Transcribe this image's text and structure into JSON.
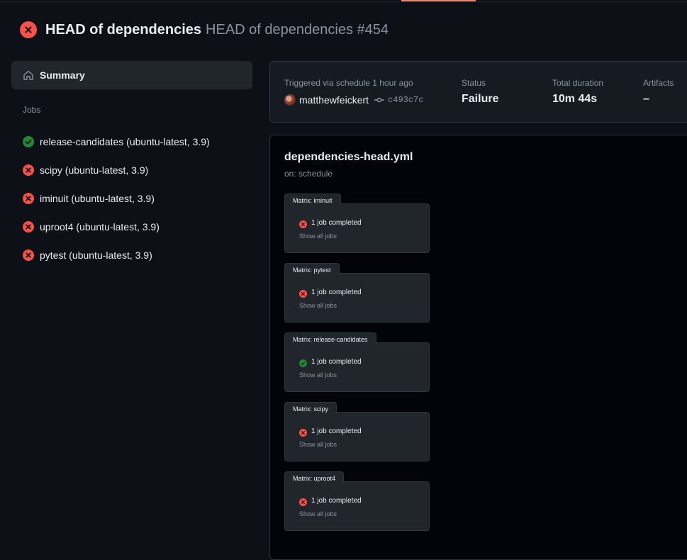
{
  "header": {
    "workflow_title": "HEAD of dependencies",
    "run_title": "HEAD of dependencies #454"
  },
  "sidebar": {
    "summary_label": "Summary",
    "jobs_heading": "Jobs",
    "jobs": [
      {
        "label": "release-candidates (ubuntu-latest, 3.9)",
        "status": "success"
      },
      {
        "label": "scipy (ubuntu-latest, 3.9)",
        "status": "failure"
      },
      {
        "label": "iminuit (ubuntu-latest, 3.9)",
        "status": "failure"
      },
      {
        "label": "uproot4 (ubuntu-latest, 3.9)",
        "status": "failure"
      },
      {
        "label": "pytest (ubuntu-latest, 3.9)",
        "status": "failure"
      }
    ]
  },
  "run_info": {
    "triggered_label": "Triggered via schedule 1 hour ago",
    "actor": "matthewfeickert",
    "commit_sha": "c493c7c",
    "status_label": "Status",
    "status_value": "Failure",
    "duration_label": "Total duration",
    "duration_value": "10m 44s",
    "artifacts_label": "Artifacts",
    "artifacts_value": "–"
  },
  "workflow": {
    "file_name": "dependencies-head.yml",
    "trigger": "on: schedule",
    "matrices": [
      {
        "label": "Matrix: iminuit",
        "status": "failure",
        "summary": "1 job completed",
        "show_all": "Show all jobs"
      },
      {
        "label": "Matrix: pytest",
        "status": "failure",
        "summary": "1 job completed",
        "show_all": "Show all jobs"
      },
      {
        "label": "Matrix: release-candidates",
        "status": "success",
        "summary": "1 job completed",
        "show_all": "Show all jobs"
      },
      {
        "label": "Matrix: scipy",
        "status": "failure",
        "summary": "1 job completed",
        "show_all": "Show all jobs"
      },
      {
        "label": "Matrix: uproot4",
        "status": "failure",
        "summary": "1 job completed",
        "show_all": "Show all jobs"
      }
    ]
  },
  "colors": {
    "failure": "#f85149",
    "success": "#238636",
    "accent": "#f78166"
  }
}
